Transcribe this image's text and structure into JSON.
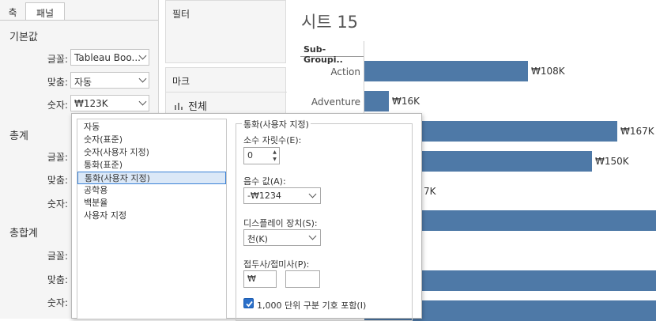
{
  "tabs": [
    {
      "label": "축"
    },
    {
      "label": "패널"
    }
  ],
  "sections": {
    "default": {
      "title": "기본값",
      "font_label": "글꼴:",
      "font_value": "Tableau Boo...",
      "align_label": "맞춤:",
      "align_value": "자동",
      "number_label": "숫자:",
      "number_value": "₩123K"
    },
    "totals": {
      "title": "총계",
      "font_label": "글꼴:",
      "align_label": "맞춤:",
      "number_label": "숫자:"
    },
    "grand_totals": {
      "title": "총합계",
      "font_label": "글꼴:",
      "align_label": "맞춤:",
      "number_label": "숫자:"
    }
  },
  "filters": {
    "title": "필터"
  },
  "marks": {
    "title": "마크",
    "all_label": "전체",
    "icon": "bar-chart-icon"
  },
  "worksheet": {
    "title": "시트 15",
    "row_header": "Sub-Groupi..",
    "bar_color": "#4e79a7"
  },
  "chart_data": {
    "type": "bar",
    "orientation": "horizontal",
    "categories": [
      "Action",
      "Adventure"
    ],
    "values": [
      108,
      16
    ],
    "value_labels": [
      "₩108K",
      "₩16K",
      "₩167K",
      "₩150K",
      "7K"
    ],
    "partially_visible_values": [
      167,
      150
    ],
    "unit": "K"
  },
  "number_format_popup": {
    "list": [
      "자동",
      "숫자(표준)",
      "숫자(사용자 지정)",
      "통화(표준)",
      "통화(사용자 지정)",
      "공학용",
      "백분율",
      "사용자 지정"
    ],
    "selected_index": 4,
    "group_title": "통화(사용자 지정)",
    "decimals_label": "소수 자릿수(E):",
    "decimals_value": "0",
    "negative_label": "음수 값(A):",
    "negative_value": "-₩1234",
    "display_unit_label": "디스플레이 장치(S):",
    "display_unit_value": "천(K)",
    "prefix_suffix_label": "접두사/접미사(P):",
    "prefix_value": "₩",
    "suffix_value": "",
    "thousands_separator_label": "1,000 단위 구분 기호 포함(I)",
    "thousands_separator_checked": true
  }
}
